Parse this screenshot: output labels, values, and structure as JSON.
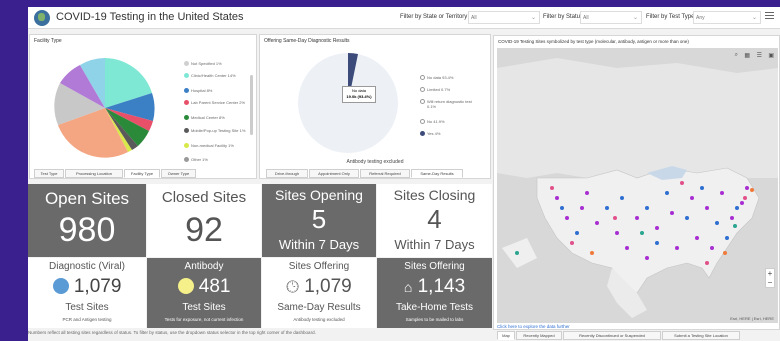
{
  "header": {
    "title": "COVID-19 Testing in the United States",
    "filters": [
      {
        "label": "Filter by State or Territory",
        "value": "All"
      },
      {
        "label": "Filter by Status",
        "value": "All"
      },
      {
        "label": "Filter by Test Type",
        "value": "Any"
      }
    ]
  },
  "facility_panel": {
    "title": "Facility Type",
    "legend": [
      {
        "label": "Not Specified 1%",
        "color": "#d0d0d0"
      },
      {
        "label": "Clinic/Health Center 14%",
        "color": "#7fe8d5"
      },
      {
        "label": "Hospital 8%",
        "color": "#3b7fc4"
      },
      {
        "label": "Lab Parent Service Center 2%",
        "color": "#e8506a"
      },
      {
        "label": "Medical Center 8%",
        "color": "#2a8a3a"
      },
      {
        "label": "Mobile/Pop-up Testing Site 1%",
        "color": "#5a5a5a"
      },
      {
        "label": "Non-medical Facility 1%",
        "color": "#d8e84a"
      },
      {
        "label": "Other 1%",
        "color": "#9a9a9a"
      }
    ],
    "tabs": [
      "Test Type",
      "Processing Location",
      "Facility Type",
      "Owner Type"
    ]
  },
  "sameday_panel": {
    "title": "Offering Same-Day Diagnostic Results",
    "tooltip": {
      "line1": "No data",
      "line2": "19.0k (93.4%)"
    },
    "legend": [
      {
        "label": "No data 93.4%",
        "color": "#ffffff"
      },
      {
        "label": "Limited 0.7%",
        "color": "#ffffff"
      },
      {
        "label": "Will return diagnostic test 0.1%",
        "color": "#ffffff"
      },
      {
        "label": "No 41.9%",
        "color": "#ffffff"
      },
      {
        "label": "Yes 4%",
        "color": "#3c4b7a"
      }
    ],
    "note": "Antibody testing excluded",
    "tabs": [
      "Drive-through",
      "Appointment Only",
      "Referral Required",
      "Same-Day Results"
    ]
  },
  "stats": {
    "open": {
      "label": "Open Sites",
      "value": "980"
    },
    "closed": {
      "label": "Closed Sites",
      "value": "92"
    },
    "opening": {
      "label": "Sites Opening",
      "value": "5",
      "sub": "Within 7 Days"
    },
    "closing": {
      "label": "Sites Closing",
      "value": "4",
      "sub": "Within 7 Days"
    },
    "diagnostic": {
      "label": "Diagnostic (Viral)",
      "value": "1,079",
      "sub": "Test Sites",
      "note": "PCR and Antigen testing"
    },
    "antibody": {
      "label": "Antibody",
      "value": "481",
      "sub": "Test Sites",
      "note": "Tests for exposure, not current infection"
    },
    "sameday": {
      "label": "Sites Offering",
      "value": "1,079",
      "sub": "Same-Day Results",
      "note": "Antibody testing excluded"
    },
    "takehome": {
      "label": "Sites Offering",
      "value": "1,143",
      "sub": "Take-Home Tests",
      "note": "Samples to be mailed to labs"
    }
  },
  "footnote": "Numbers reflect all testing sites regardless of status. To filter by status, use the dropdown status selector in the top right corner of the dashboard.",
  "map_panel": {
    "title": "COVID-19 Testing Sites symbolized by test type (molecular, antibody, antigen or more than one)",
    "explore_link": "Click here to explore the data further",
    "attribution": "Esri, HERE | Esri, HERE",
    "tabs": [
      "Map",
      "Recently Mapped",
      "Recently Discontinued or Suspended",
      "Submit a Testing Site Location"
    ]
  },
  "colors": {
    "dark_tile": "#6a6a6a",
    "diagnostic_dot": "#5b9bd5",
    "antibody_dot": "#f5f08a",
    "background": "#3a1f8f"
  }
}
